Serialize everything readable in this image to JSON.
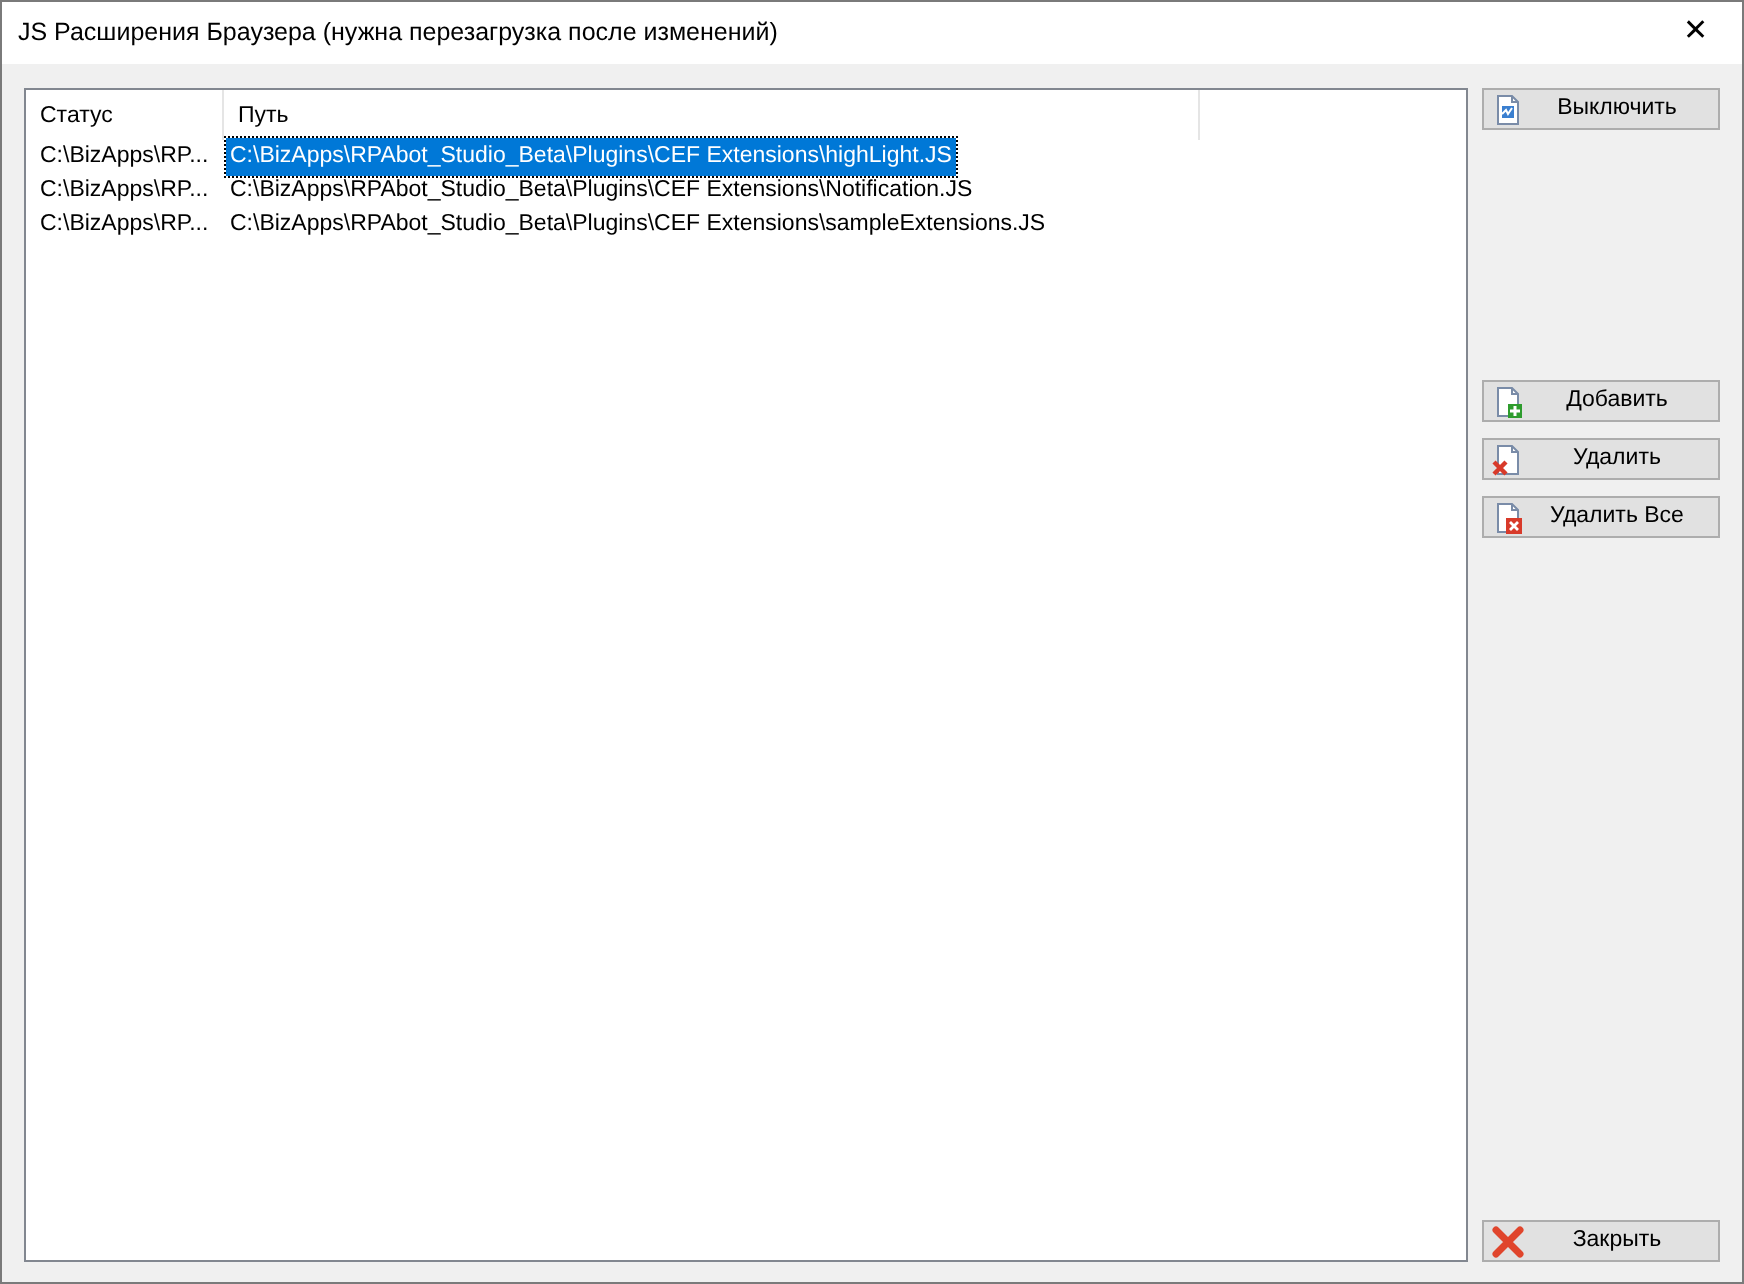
{
  "window": {
    "title": "JS Расширения Браузера (нужна перезагрузка после изменений)",
    "close": "✕"
  },
  "table": {
    "columns": [
      "Статус",
      "Путь"
    ],
    "rows": [
      {
        "status": "C:\\BizApps\\RP...",
        "path": "C:\\BizApps\\RPAbot_Studio_Beta\\Plugins\\CEF Extensions\\highLight.JS",
        "selected": true
      },
      {
        "status": "C:\\BizApps\\RP...",
        "path": "C:\\BizApps\\RPAbot_Studio_Beta\\Plugins\\CEF Extensions\\Notification.JS",
        "selected": false
      },
      {
        "status": "C:\\BizApps\\RP...",
        "path": "C:\\BizApps\\RPAbot_Studio_Beta\\Plugins\\CEF Extensions\\sampleExtensions.JS",
        "selected": false
      }
    ]
  },
  "side_buttons": {
    "top": [
      {
        "label": "Выключить",
        "kind": "toggle"
      }
    ],
    "middle": [
      {
        "label": "Добавить",
        "kind": "add"
      },
      {
        "label": "Удалить",
        "kind": "remove"
      },
      {
        "label": "Удалить Все",
        "kind": "remove-all"
      }
    ],
    "bottom": [
      {
        "label": "Закрыть",
        "kind": "close"
      }
    ]
  }
}
